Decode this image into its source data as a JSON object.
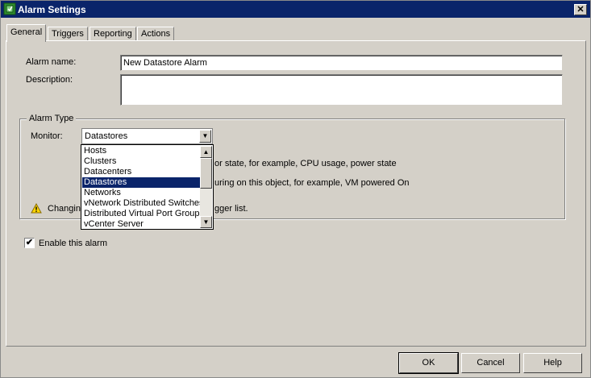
{
  "window": {
    "title": "Alarm Settings",
    "close_glyph": "✕"
  },
  "tabs": [
    {
      "label": "General",
      "active": true
    },
    {
      "label": "Triggers",
      "active": false
    },
    {
      "label": "Reporting",
      "active": false
    },
    {
      "label": "Actions",
      "active": false
    }
  ],
  "general": {
    "alarm_name_label": "Alarm name:",
    "alarm_name_value": "New Datastore Alarm",
    "description_label": "Description:",
    "description_value": "",
    "alarm_type": {
      "legend": "Alarm Type",
      "monitor_label": "Monitor:",
      "monitor_value": "Datastores",
      "option1_text": "or state, for example, CPU usage, power state",
      "option2_text": "uring on this object, for example, VM powered On",
      "warning_prefix": "Changing",
      "warning_suffix": "gger list."
    },
    "monitor_options": [
      "Hosts",
      "Clusters",
      "Datacenters",
      "Datastores",
      "Networks",
      "vNetwork Distributed Switches",
      "Distributed Virtual Port Groups",
      "vCenter Server"
    ],
    "selected_option": "Datastores",
    "enable_checked": true,
    "enable_label": "Enable this alarm"
  },
  "buttons": {
    "ok": "OK",
    "cancel": "Cancel",
    "help": "Help"
  },
  "colors": {
    "title_bar": "#0a246a",
    "selection": "#0a246a",
    "face": "#d4d0c8"
  },
  "icons": {
    "app": "vsphere-alarm-icon",
    "warning": "warning-triangle-icon"
  }
}
